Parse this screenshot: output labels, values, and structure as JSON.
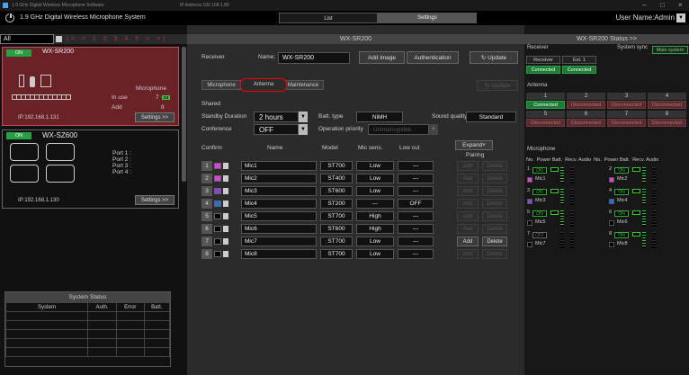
{
  "titlebar": {
    "software": "1.9 GHz Digital Wireless Microphone Software",
    "ip": "IP Address:192.168.1.80",
    "min": "–",
    "max": "□",
    "close": "×"
  },
  "app": {
    "title": "1.9 GHz Digital Wireless Microphone System",
    "tab_list": "List",
    "tab_settings": "Settings",
    "user": "User Name:Admin"
  },
  "left": {
    "filter": "All",
    "pager": "|< < 1 2 3 4 5 > >|",
    "receivers": [
      {
        "status": "ON",
        "name": "WX-SR200",
        "microphone_label": "Microphone",
        "in_use_label": "In use",
        "in_use_value": "7",
        "add_label": "Add",
        "add_value": "8",
        "ip": "IP:192.168.1.131",
        "settings": "Settings >>"
      },
      {
        "status": "ON",
        "name": "WX-SZ600",
        "ports": [
          "Port 1 :",
          "Port 2 :",
          "Port 3 :",
          "Port 4 :"
        ],
        "ip": "IP:192.168.1.130",
        "settings": "Settings >>"
      }
    ],
    "system_status": {
      "title": "System Status",
      "headers": [
        "System",
        "Auth.",
        "Error",
        "Batt."
      ]
    }
  },
  "middle": {
    "header": "WX-SR200",
    "receiver_label": "Receiver",
    "name_label": "Name:",
    "name_value": "WX-SR200",
    "add_image": "Add image",
    "authentication": "Authentication",
    "update": "Update",
    "tabs": [
      "Microphone",
      "Antenna",
      "Maintenance"
    ],
    "update2": "Update",
    "shared": "Shared",
    "standby_label": "Standby Duration",
    "standby_value": "2 hours",
    "batt_label": "Batt. type",
    "batt_value": "NiMH",
    "sound_label": "Sound quality",
    "sound_value": "Standard",
    "conference_label": "Conference",
    "conference_value": "OFF",
    "priority_label": "Operation priority",
    "priority_value": "Uninterruptible",
    "headers": {
      "confirm": "Confirm",
      "name": "Name",
      "model": "Model",
      "sens": "Mic sens.",
      "lowcut": "Low cut",
      "expand": "Expand",
      "pairing": "Pairing"
    },
    "mics": [
      {
        "n": "1",
        "color": "#e040e0",
        "name": "Mic1",
        "model": "ST700",
        "sens": "Low",
        "lowcut": "---",
        "add": "Add",
        "del": "Delete",
        "add_en": false,
        "del_en": false
      },
      {
        "n": "2",
        "color": "#e040e0",
        "name": "Mic2",
        "model": "ST400",
        "sens": "Low",
        "lowcut": "---",
        "add": "Add",
        "del": "Delete",
        "add_en": false,
        "del_en": false
      },
      {
        "n": "3",
        "color": "#9040e0",
        "name": "Mic3",
        "model": "ST600",
        "sens": "Low",
        "lowcut": "---",
        "add": "Add",
        "del": "Delete",
        "add_en": false,
        "del_en": false
      },
      {
        "n": "4",
        "color": "#2070e0",
        "name": "Mic4",
        "model": "ST200",
        "sens": "---",
        "lowcut": "OFF",
        "add": "Add",
        "del": "Delete",
        "add_en": false,
        "del_en": false
      },
      {
        "n": "5",
        "color": "#000000",
        "name": "Mic5",
        "model": "ST700",
        "sens": "High",
        "lowcut": "---",
        "add": "Add",
        "del": "Delete",
        "add_en": false,
        "del_en": false
      },
      {
        "n": "6",
        "color": "#000000",
        "name": "Mic6",
        "model": "ST600",
        "sens": "High",
        "lowcut": "---",
        "add": "Add",
        "del": "Delete",
        "add_en": false,
        "del_en": false
      },
      {
        "n": "7",
        "color": "#000000",
        "name": "Mic7",
        "model": "ST700",
        "sens": "Low",
        "lowcut": "---",
        "add": "Add",
        "del": "Delete",
        "add_en": true,
        "del_en": true
      },
      {
        "n": "8",
        "color": "#000000",
        "name": "Mic8",
        "model": "ST700",
        "sens": "Low",
        "lowcut": "---",
        "add": "Add",
        "del": "Delete",
        "add_en": false,
        "del_en": false
      }
    ]
  },
  "right": {
    "header": "WX-SR200 Status >>",
    "receiver_label": "Receiver",
    "system_sync_label": "System sync",
    "system_sync_value": "Main system",
    "receiver_cols": [
      "Receiver",
      "Ext. 1"
    ],
    "receiver_status": [
      "Connected",
      "Connected"
    ],
    "antenna_label": "Antenna",
    "antenna_nums": [
      "1",
      "2",
      "3",
      "4",
      "5",
      "6",
      "7",
      "8"
    ],
    "antenna_status": [
      "Connected",
      "Disconnected",
      "Disconnected",
      "Disconnected",
      "Disconnected",
      "Disconnected",
      "Disconnected",
      "Disconnected"
    ],
    "microphone_label": "Microphone",
    "mic_headers": "No.  Power Batt.  Recv. Audio  No.  Power Batt.  Recv. Audio",
    "mics": [
      {
        "n": "1",
        "power": "ON",
        "name": "Mic1",
        "color": "#e040e0"
      },
      {
        "n": "2",
        "power": "ON",
        "name": "Mic2",
        "color": "#e040e0"
      },
      {
        "n": "3",
        "power": "ON",
        "name": "Mic3",
        "color": "#9040e0"
      },
      {
        "n": "4",
        "power": "ON",
        "name": "Mic4",
        "color": "#2070e0"
      },
      {
        "n": "5",
        "power": "ON",
        "name": "Mic5",
        "color": "#000000"
      },
      {
        "n": "6",
        "power": "ON",
        "name": "Mic6",
        "color": "#000000"
      },
      {
        "n": "7",
        "power": "OFF",
        "name": "Mic7",
        "color": "#000000"
      },
      {
        "n": "8",
        "power": "ON",
        "name": "Mic8",
        "color": "#000000"
      }
    ]
  }
}
